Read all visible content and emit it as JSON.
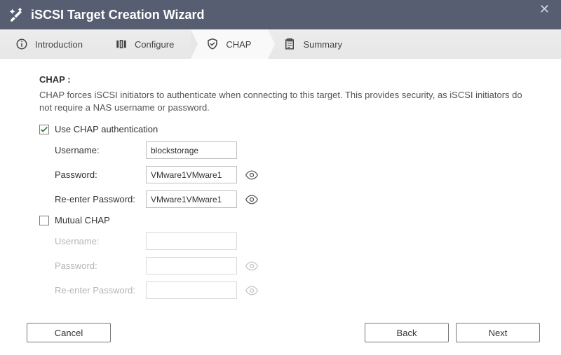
{
  "titlebar": {
    "title": "iSCSI Target Creation Wizard"
  },
  "steps": {
    "introduction": "Introduction",
    "configure": "Configure",
    "chap": "CHAP",
    "summary": "Summary"
  },
  "section": {
    "heading": "CHAP :",
    "description": "CHAP forces iSCSI initiators to authenticate when connecting to this target. This provides security, as iSCSI initiators do not require a NAS username or password."
  },
  "chap": {
    "use_label": "Use CHAP authentication",
    "username_label": "Username:",
    "username_value": "blockstorage",
    "password_label": "Password:",
    "password_value": "VMware1VMware1",
    "reenter_label": "Re-enter Password:",
    "reenter_value": "VMware1VMware1"
  },
  "mutual": {
    "label": "Mutual CHAP",
    "username_label": "Username:",
    "username_value": "",
    "password_label": "Password:",
    "password_value": "",
    "reenter_label": "Re-enter Password:",
    "reenter_value": ""
  },
  "buttons": {
    "cancel": "Cancel",
    "back": "Back",
    "next": "Next"
  }
}
